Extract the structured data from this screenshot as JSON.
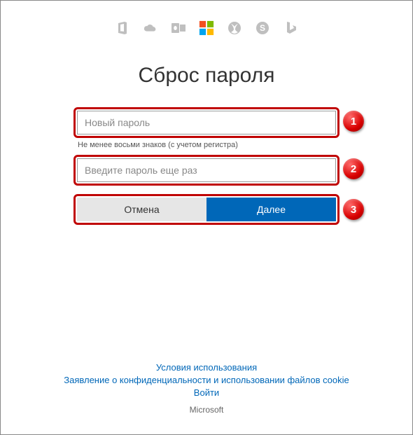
{
  "icons": {
    "office": "office-icon",
    "onedrive": "onedrive-icon",
    "outlook": "outlook-icon",
    "windows": "windows-icon",
    "xbox": "xbox-icon",
    "skype": "skype-icon",
    "bing": "bing-icon"
  },
  "title": "Сброс пароля",
  "form": {
    "new_password_placeholder": "Новый пароль",
    "hint": "Не менее восьми знаков (с учетом регистра)",
    "confirm_password_placeholder": "Введите пароль еще раз",
    "cancel_label": "Отмена",
    "next_label": "Далее"
  },
  "markers": {
    "one": "1",
    "two": "2",
    "three": "3"
  },
  "footer": {
    "terms": "Условия использования",
    "privacy": "Заявление о конфиденциальности и использовании файлов cookie",
    "signin": "Войти",
    "brand": "Microsoft"
  },
  "colors": {
    "accent": "#0067b8",
    "highlight": "#c00404"
  }
}
